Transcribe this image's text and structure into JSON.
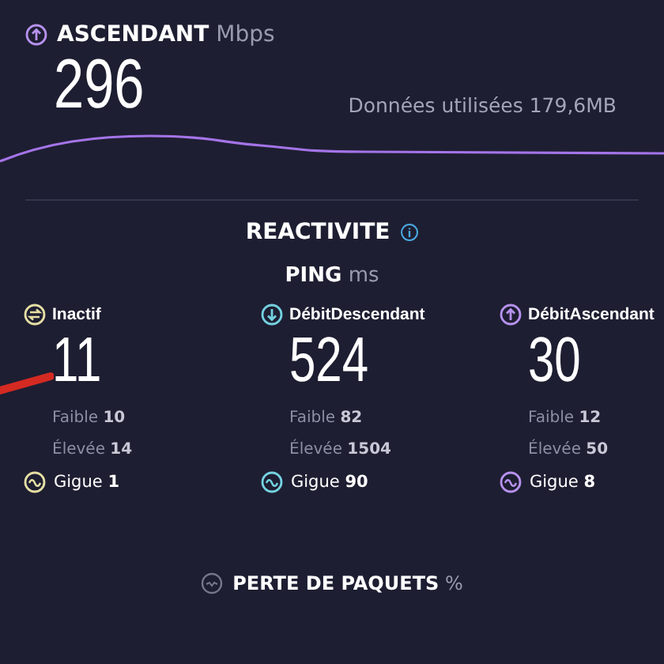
{
  "upload": {
    "title": "ASCENDANT",
    "unit": "Mbps",
    "value": "296",
    "data_used": "Données utilisées 179,6MB"
  },
  "responsiveness": {
    "title": "REACTIVITE",
    "ping_title": "PING",
    "ping_unit": "ms",
    "columns": [
      {
        "kind": "idle",
        "label": "Inactif",
        "value": "11",
        "color": "#e6e0a4",
        "low_label": "Faible",
        "low": "10",
        "high_label": "Élevée",
        "high": "14",
        "jitter_label": "Gigue",
        "jitter": "1"
      },
      {
        "kind": "down",
        "label": "DébitDescendant",
        "value": "524",
        "color": "#74d2e0",
        "low_label": "Faible",
        "low": "82",
        "high_label": "Élevée",
        "high": "1504",
        "jitter_label": "Gigue",
        "jitter": "90"
      },
      {
        "kind": "up",
        "label": "DébitAscendant",
        "value": "30",
        "color": "#b792ee",
        "low_label": "Faible",
        "low": "12",
        "high_label": "Élevée",
        "high": "50",
        "jitter_label": "Gigue",
        "jitter": "8"
      }
    ]
  },
  "packet_loss": {
    "title": "PERTE DE PAQUETS",
    "unit": "%"
  }
}
